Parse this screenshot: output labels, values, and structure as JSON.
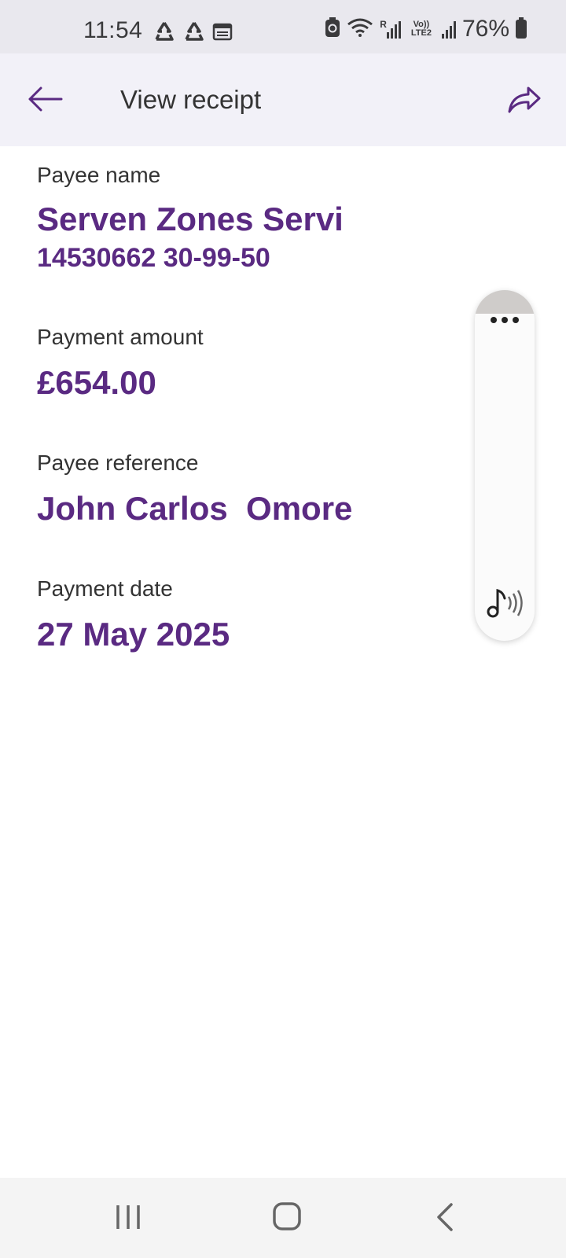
{
  "status_bar": {
    "time": "11:54",
    "battery": "76%",
    "lte_label": "Vo)) LTE2",
    "roaming_label": "R",
    "icons": [
      "recycle-icon",
      "recycle-icon",
      "calendar-icon",
      "battery-saver-icon",
      "wifi-icon",
      "signal-icon",
      "signal-icon",
      "battery-icon"
    ]
  },
  "app_bar": {
    "title": "View receipt",
    "back_icon": "arrow-left-icon",
    "share_icon": "share-arrow-icon"
  },
  "receipt": {
    "payee_name_label": "Payee name",
    "payee_name": "Serven Zones Servi",
    "account_details": "14530662 30-99-50",
    "amount_label": "Payment amount",
    "amount": "£654.00",
    "reference_label": "Payee reference",
    "reference": "John Carlos  Omore",
    "date_label": "Payment date",
    "date": "27 May 2025"
  },
  "floating_panel": {
    "menu_icon": "more-dots-icon",
    "audio_icon": "audio-note-icon"
  },
  "nav_bar": {
    "icons": [
      "recents-icon",
      "home-icon",
      "back-chevron-icon"
    ]
  },
  "colors": {
    "accent_purple": "#5a2a82",
    "status_bar_bg": "#e9e8ee",
    "app_bar_bg": "#f2f1f8",
    "nav_bar_bg": "#f4f4f4"
  }
}
